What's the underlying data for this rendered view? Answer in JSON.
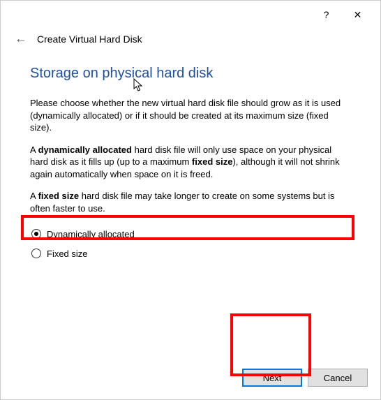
{
  "titlebar": {
    "help": "?",
    "close": "✕"
  },
  "header": {
    "back": "←",
    "title": "Create Virtual Hard Disk"
  },
  "heading": "Storage on physical hard disk",
  "para1_a": "Please choose whether the new virtual hard disk file should grow as it is used (dynamically allocated) or if it should be created at its maximum size (fixed size).",
  "para2_a": "A ",
  "para2_b": "dynamically allocated",
  "para2_c": " hard disk file will only use space on your physical hard disk as it fills up (up to a maximum ",
  "para2_d": "fixed size",
  "para2_e": "), although it will not shrink again automatically when space on it is freed.",
  "para3_a": "A ",
  "para3_b": "fixed size",
  "para3_c": " hard disk file may take longer to create on some systems but is often faster to use.",
  "options": {
    "dynamic": "Dynamically allocated",
    "fixed": "Fixed size"
  },
  "buttons": {
    "next": "Next",
    "cancel": "Cancel"
  }
}
